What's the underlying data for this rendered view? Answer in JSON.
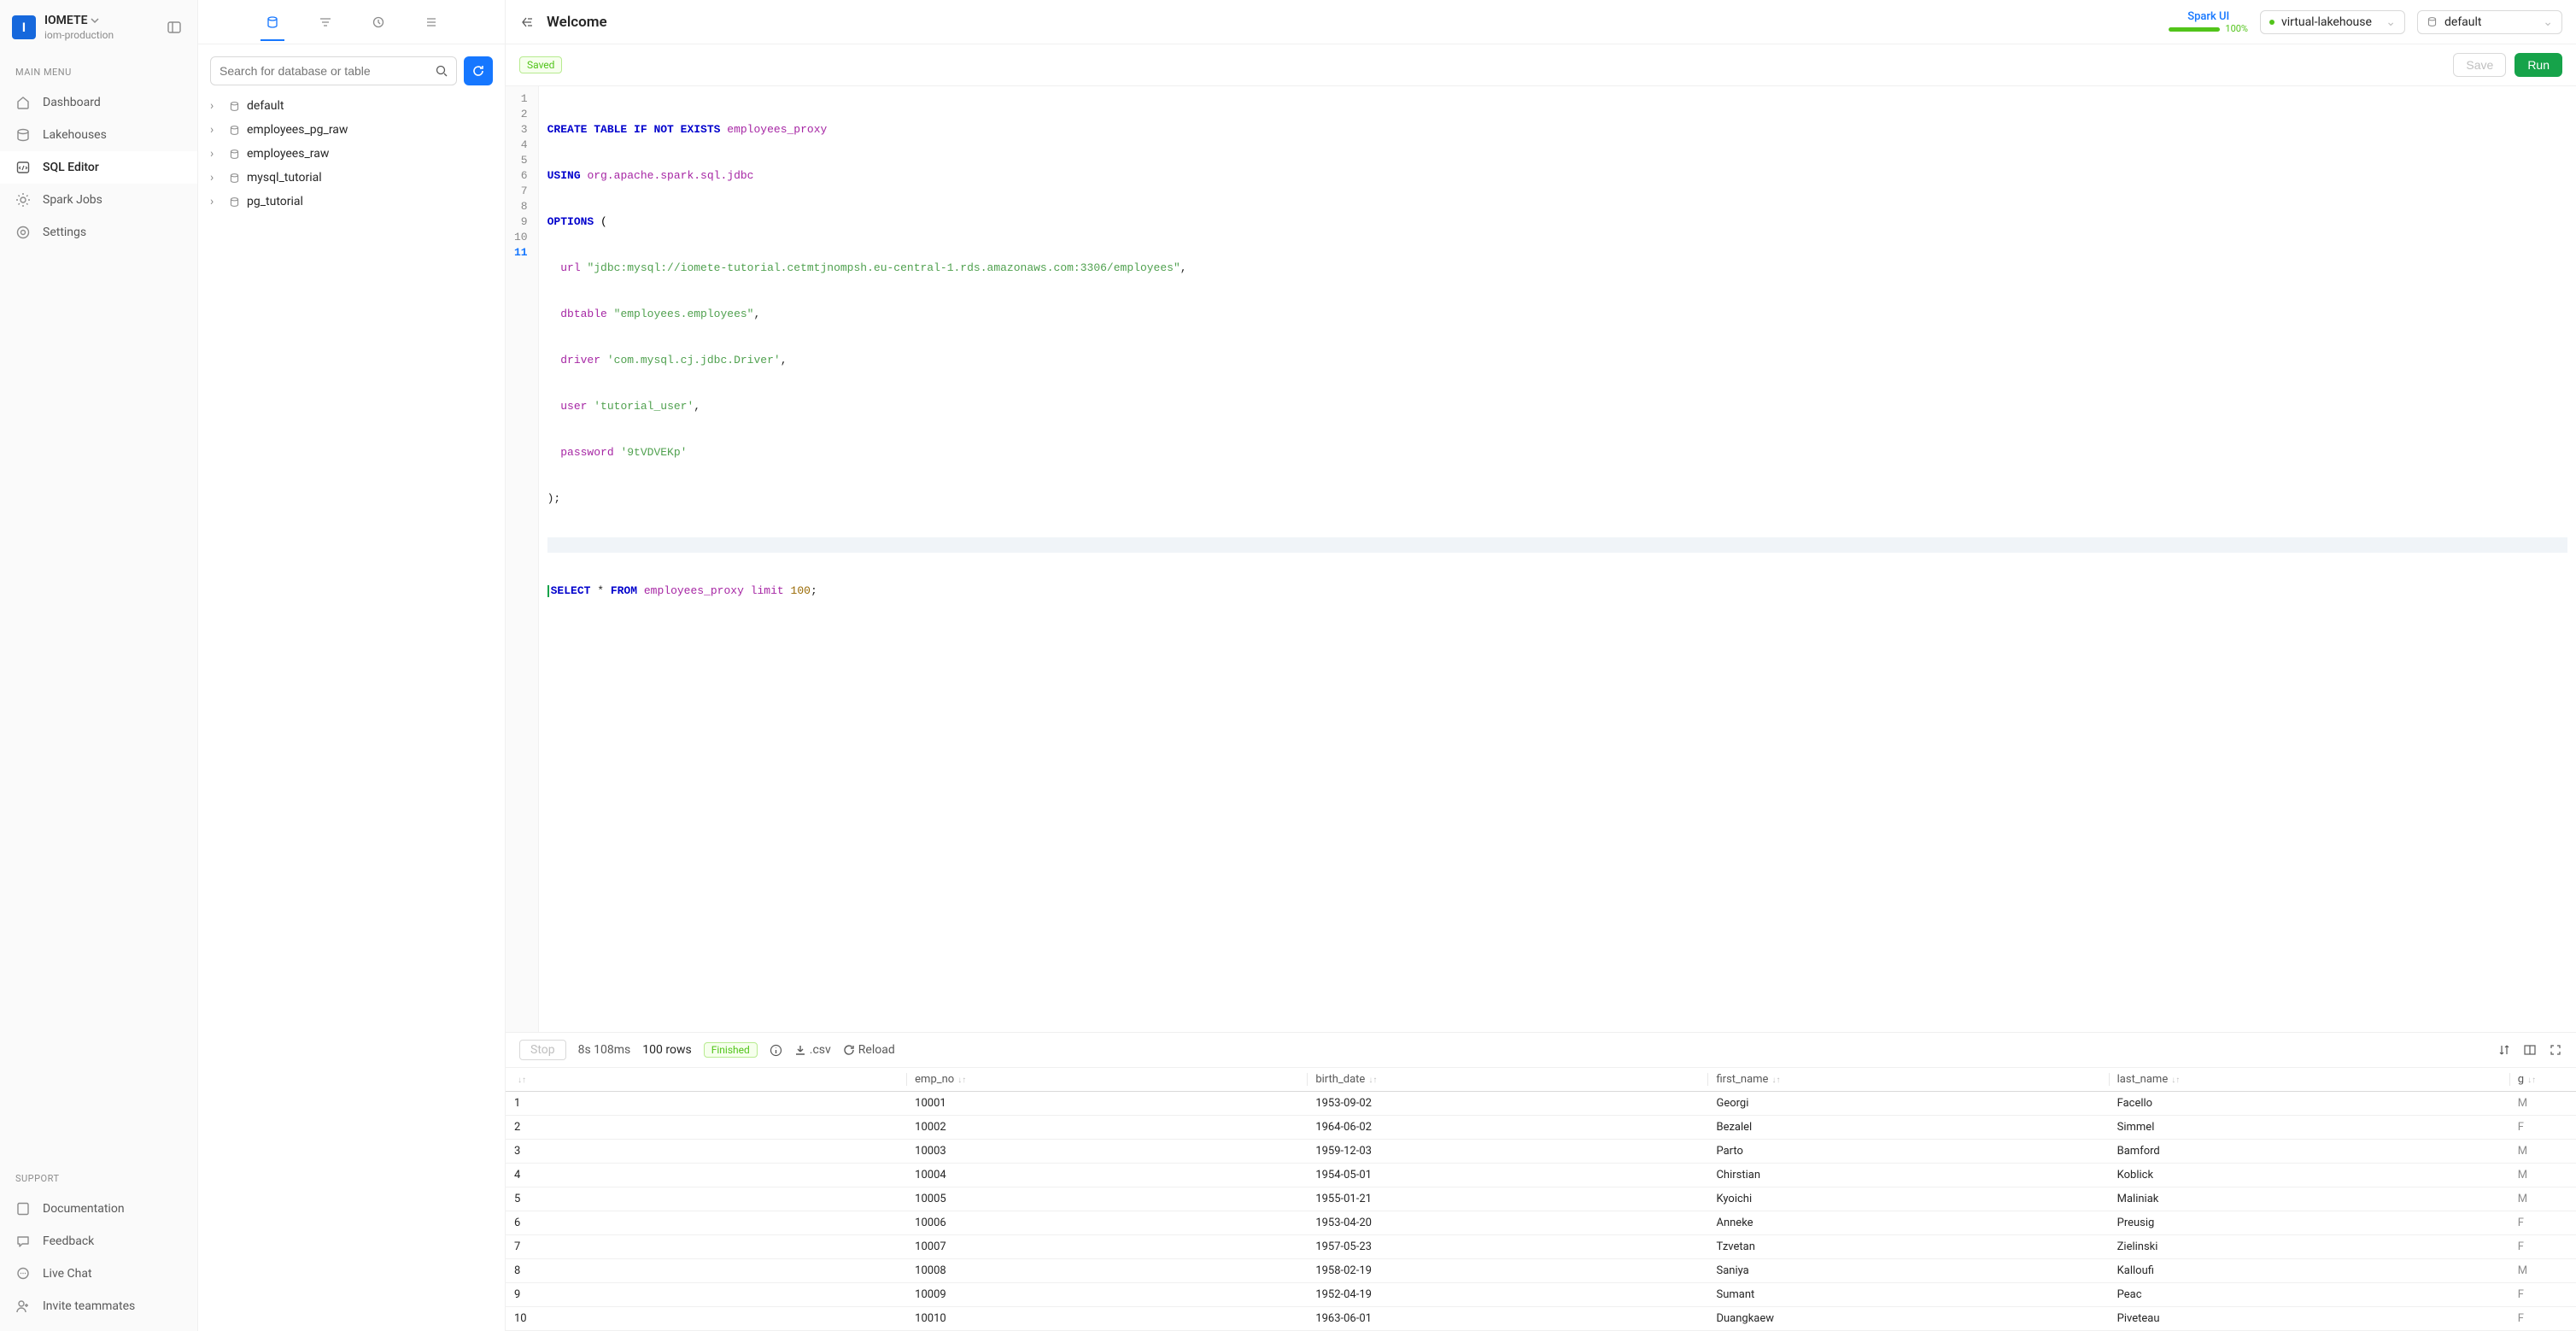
{
  "workspace": {
    "name": "IOMETE",
    "sub": "iom-production"
  },
  "sidebar": {
    "main_heading": "MAIN MENU",
    "support_heading": "SUPPORT",
    "items": [
      {
        "label": "Dashboard"
      },
      {
        "label": "Lakehouses"
      },
      {
        "label": "SQL Editor"
      },
      {
        "label": "Spark Jobs"
      },
      {
        "label": "Settings"
      }
    ],
    "support_items": [
      {
        "label": "Documentation"
      },
      {
        "label": "Feedback"
      },
      {
        "label": "Live Chat"
      },
      {
        "label": "Invite teammates"
      }
    ]
  },
  "browser": {
    "search_placeholder": "Search for database or table",
    "databases": [
      "default",
      "employees_pg_raw",
      "employees_raw",
      "mysql_tutorial",
      "pg_tutorial"
    ]
  },
  "editor_header": {
    "title": "Welcome",
    "sparkui_label": "Spark UI",
    "sparkui_pct": "100%",
    "lakehouse": "virtual-lakehouse",
    "schema": "default",
    "saved_badge": "Saved",
    "save_btn": "Save",
    "run_btn": "Run"
  },
  "code": {
    "lines": 11,
    "current_line": 11,
    "l1_kw": "CREATE TABLE",
    "l1_kw2": "IF NOT EXISTS",
    "l1_id": "employees_proxy",
    "l2_kw": "USING",
    "l2_id": "org.apache.spark.sql.jdbc",
    "l3_kw": "OPTIONS",
    "l3_op": " (",
    "l4_key": "url",
    "l4_str": "\"jdbc:mysql://iomete-tutorial.cetmtjnompsh.eu-central-1.rds.amazonaws.com:3306/employees\"",
    "l5_key": "dbtable",
    "l5_str": "\"employees.employees\"",
    "l6_key": "driver",
    "l6_str": "'com.mysql.cj.jdbc.Driver'",
    "l7_key": "user",
    "l7_str": "'tutorial_user'",
    "l8_key": "password",
    "l8_str": "'9tVDVEKp'",
    "l9": ");",
    "l11_kw": "SELECT",
    "l11_star": " * ",
    "l11_kw2": "FROM",
    "l11_tbl": "employees_proxy",
    "l11_limit": "limit",
    "l11_num": "100"
  },
  "results_bar": {
    "stop": "Stop",
    "timing": "8s 108ms",
    "rows": "100 rows",
    "finished": "Finished",
    "csv": ".csv",
    "reload": "Reload"
  },
  "table": {
    "columns": [
      "",
      "emp_no",
      "birth_date",
      "first_name",
      "last_name",
      "g"
    ],
    "rows": [
      [
        "1",
        "10001",
        "1953-09-02",
        "Georgi",
        "Facello",
        "M"
      ],
      [
        "2",
        "10002",
        "1964-06-02",
        "Bezalel",
        "Simmel",
        "F"
      ],
      [
        "3",
        "10003",
        "1959-12-03",
        "Parto",
        "Bamford",
        "M"
      ],
      [
        "4",
        "10004",
        "1954-05-01",
        "Chirstian",
        "Koblick",
        "M"
      ],
      [
        "5",
        "10005",
        "1955-01-21",
        "Kyoichi",
        "Maliniak",
        "M"
      ],
      [
        "6",
        "10006",
        "1953-04-20",
        "Anneke",
        "Preusig",
        "F"
      ],
      [
        "7",
        "10007",
        "1957-05-23",
        "Tzvetan",
        "Zielinski",
        "F"
      ],
      [
        "8",
        "10008",
        "1958-02-19",
        "Saniya",
        "Kalloufi",
        "M"
      ],
      [
        "9",
        "10009",
        "1952-04-19",
        "Sumant",
        "Peac",
        "F"
      ],
      [
        "10",
        "10010",
        "1963-06-01",
        "Duangkaew",
        "Piveteau",
        "F"
      ]
    ]
  }
}
